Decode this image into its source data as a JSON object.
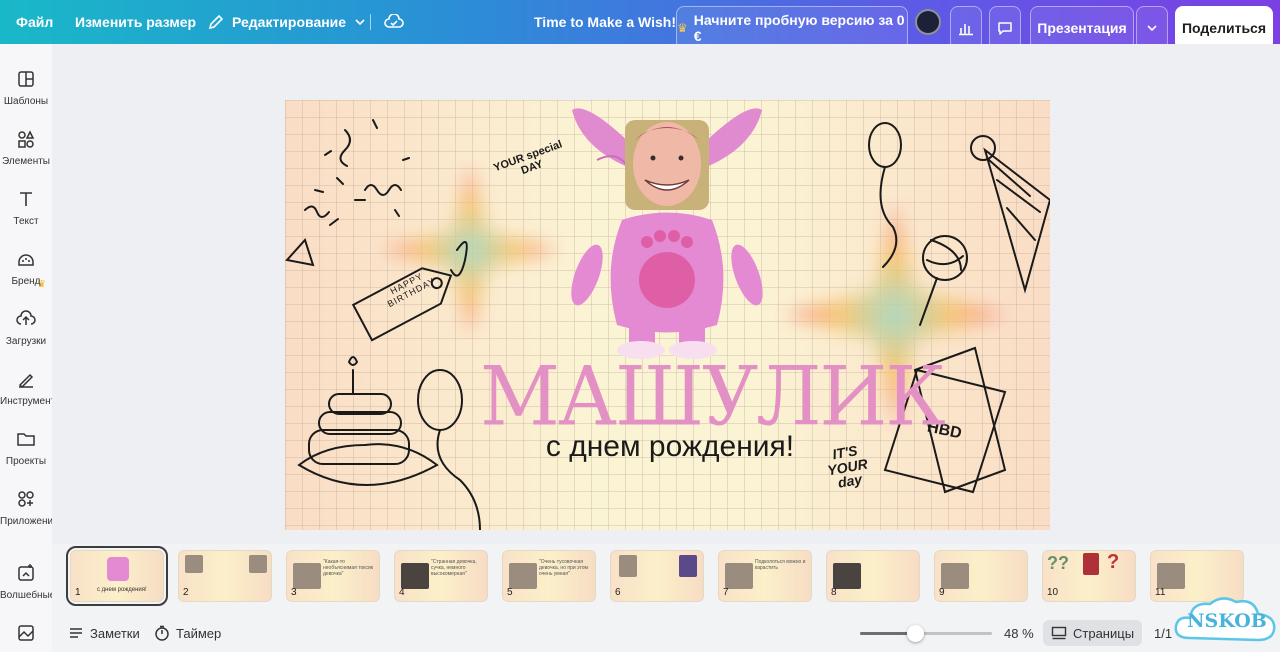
{
  "topbar": {
    "file": "Файл",
    "resize": "Изменить размер",
    "edit": "Редактирование",
    "doc_title": "Time to Make a Wish!",
    "trial": "Начните пробную версию за 0 €",
    "present": "Презентация",
    "share": "Поделиться"
  },
  "sidebar": {
    "items": [
      {
        "label": "Шаблоны",
        "icon": "templates-icon"
      },
      {
        "label": "Элементы",
        "icon": "elements-icon"
      },
      {
        "label": "Текст",
        "icon": "text-icon"
      },
      {
        "label": "Бренд",
        "icon": "brand-icon"
      },
      {
        "label": "Загрузки",
        "icon": "uploads-icon"
      },
      {
        "label": "Инструменты",
        "icon": "tools-icon"
      },
      {
        "label": "Проекты",
        "icon": "folder-icon"
      },
      {
        "label": "Приложения",
        "icon": "apps-icon"
      },
      {
        "label": "Волшебные",
        "icon": "magic-icon"
      },
      {
        "label": "",
        "icon": "photos-icon"
      }
    ]
  },
  "slide": {
    "title": "МАШУЛИК",
    "subtitle": "с днем рождения!",
    "tag_text": "HAPPY BIRTHDAY",
    "special_text": "YOUR special DAY",
    "its_your_day": "IT'S YOUR day",
    "card_text": "HBD"
  },
  "thumbnails": [
    {
      "num": "1",
      "caption": "с днем рождения!"
    },
    {
      "num": "2",
      "caption": ""
    },
    {
      "num": "3",
      "caption": "\"Какая-то необъяснимая токсик девочка\""
    },
    {
      "num": "4",
      "caption": "\"Странная девочка, сучка, немного высокомерная\""
    },
    {
      "num": "5",
      "caption": "\"Очень тусовочная девочка, но при этом очень умная\""
    },
    {
      "num": "6",
      "caption": ""
    },
    {
      "num": "7",
      "caption": "Подколоться можно и взрастить"
    },
    {
      "num": "8",
      "caption": ""
    },
    {
      "num": "9",
      "caption": ""
    },
    {
      "num": "10",
      "caption": ""
    },
    {
      "num": "11",
      "caption": ""
    }
  ],
  "bottombar": {
    "notes": "Заметки",
    "timer": "Таймер",
    "zoom": "48 %",
    "zoom_level": 0.42,
    "pages": "Страницы",
    "page_count": "1/1"
  },
  "watermark": "NSKOB",
  "colors": {
    "accent_title": "#e390c4",
    "topbar_start": "#19b8c8",
    "topbar_end": "#7c3fe4"
  }
}
